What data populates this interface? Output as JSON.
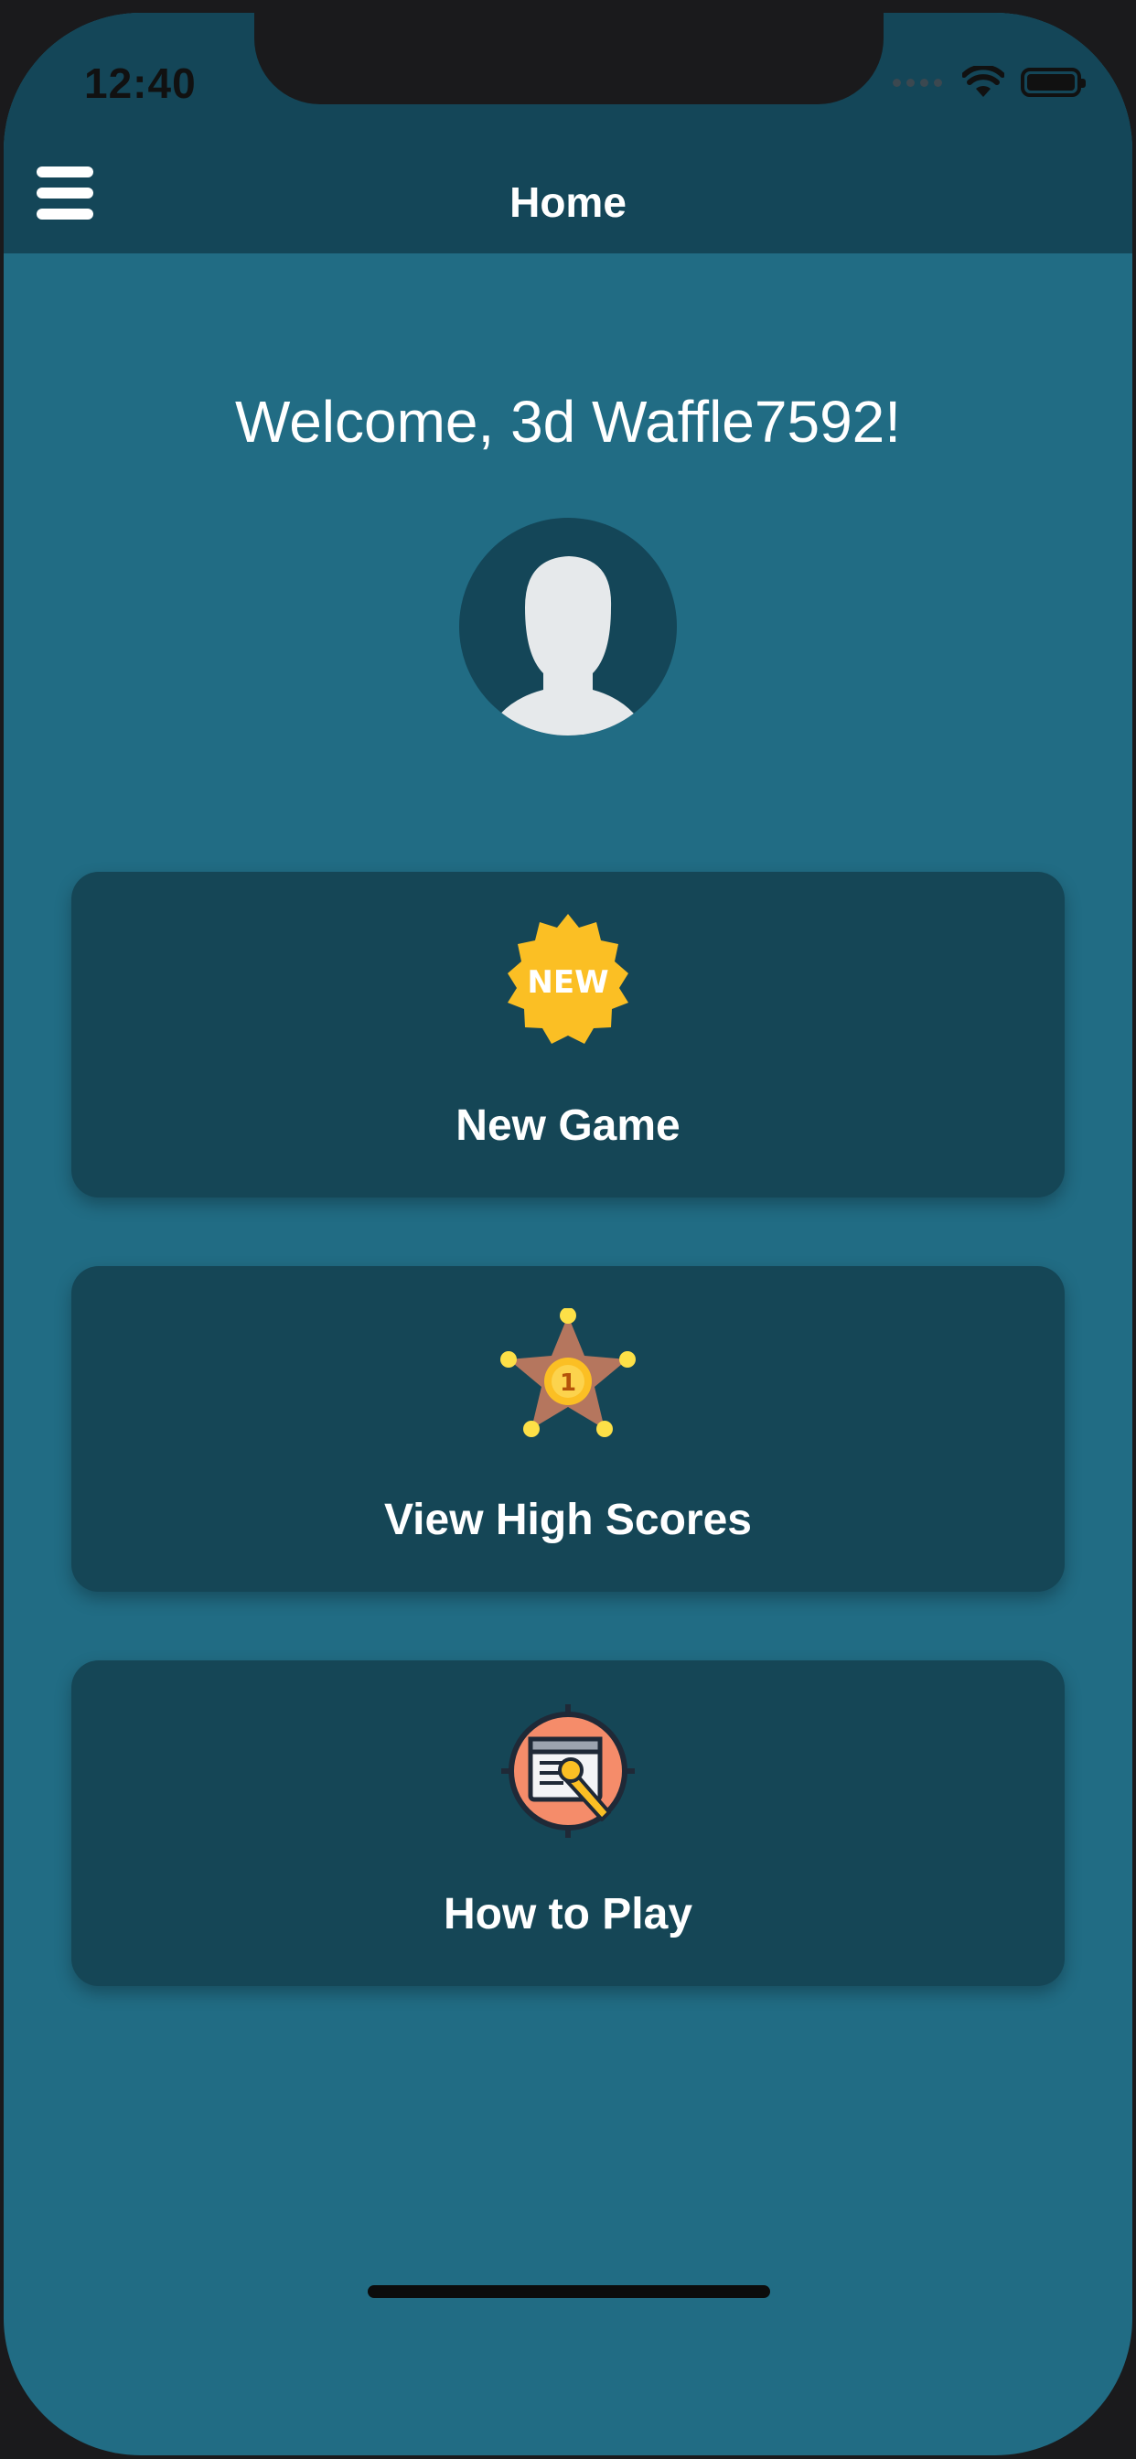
{
  "status_bar": {
    "time": "12:40"
  },
  "nav": {
    "title": "Home",
    "menu_icon": "hamburger-menu-icon"
  },
  "welcome": {
    "text": "Welcome, 3d Waffle7592!"
  },
  "avatar": {
    "icon": "user-silhouette-icon"
  },
  "menu": [
    {
      "label": "New Game",
      "icon": "new-badge-icon",
      "badge_text": "NEW"
    },
    {
      "label": "View High Scores",
      "icon": "sheriff-star-icon",
      "badge_text": "1"
    },
    {
      "label": "How to Play",
      "icon": "settings-window-icon"
    }
  ],
  "colors": {
    "background": "#216c84",
    "header": "#144658",
    "card": "#154656",
    "text": "#ffffff",
    "accent_yellow": "#fbbf24"
  }
}
